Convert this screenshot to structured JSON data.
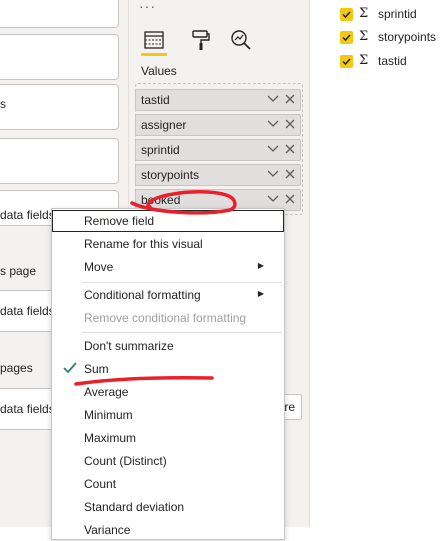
{
  "filters_pane": {
    "fragments": [
      "s",
      "data fields",
      "s page",
      "data fields",
      "pages",
      "data fields"
    ]
  },
  "viz_pane": {
    "more_glyph": "···",
    "tabs": [
      {
        "name": "fields-tab",
        "icon": "table-grid-icon",
        "active": true
      },
      {
        "name": "format-tab",
        "icon": "paint-roller-icon",
        "active": false
      },
      {
        "name": "analytics-tab",
        "icon": "magnifier-chart-icon",
        "active": false
      }
    ],
    "values_label": "Values",
    "value_fields": [
      "tastid",
      "assigner",
      "sprintid",
      "storypoints",
      "booked"
    ],
    "partial_button_text": "re"
  },
  "fields_list": [
    {
      "label": "sprintid",
      "checked": true,
      "icon": "sigma-icon"
    },
    {
      "label": "storypoints",
      "checked": true,
      "icon": "sigma-icon"
    },
    {
      "label": "tastid",
      "checked": true,
      "icon": "sigma-icon"
    }
  ],
  "context_menu": {
    "remove_field": "Remove field",
    "rename": "Rename for this visual",
    "move": "Move",
    "conditional_formatting": "Conditional formatting",
    "remove_conditional_formatting": "Remove conditional formatting",
    "dont_summarize": "Don't summarize",
    "sum": "Sum",
    "average": "Average",
    "minimum": "Minimum",
    "maximum": "Maximum",
    "count_distinct": "Count (Distinct)",
    "count": "Count",
    "std_dev": "Standard deviation",
    "variance": "Variance",
    "selected": "Sum"
  },
  "colors": {
    "accent": "#f2c811",
    "check": "#2d7d6e",
    "annotation": "#e8202a"
  }
}
